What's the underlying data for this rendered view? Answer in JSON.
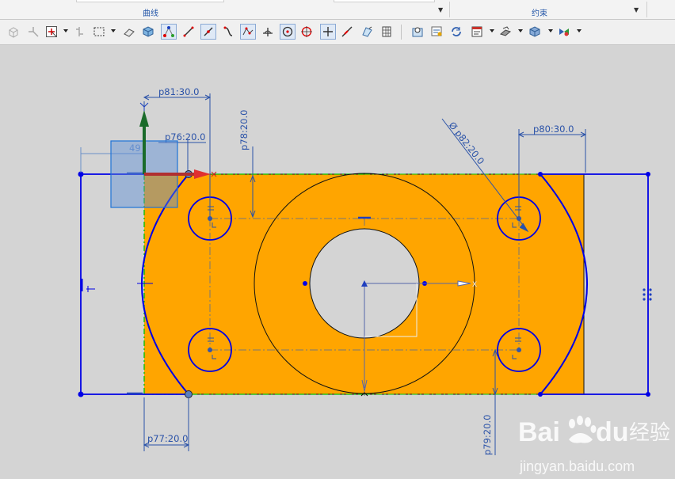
{
  "ribbon": {
    "groups": [
      {
        "title": "曲线"
      },
      {
        "title": "约束"
      }
    ]
  },
  "toolbar": {
    "tools": [
      {
        "name": "associative-model-icon"
      },
      {
        "name": "snap-point-icon"
      },
      {
        "name": "selection-filter-icon"
      },
      {
        "name": "rotate-view-icon"
      },
      {
        "name": "select-box-icon"
      },
      {
        "name": "eraser-icon"
      },
      {
        "name": "solid-box-icon"
      },
      {
        "name": "profile-icon"
      },
      {
        "name": "line-icon"
      },
      {
        "name": "line-tangent-icon"
      },
      {
        "name": "arc-icon"
      },
      {
        "name": "studio-spline-icon"
      },
      {
        "name": "fillet-icon"
      },
      {
        "name": "circle-icon"
      },
      {
        "name": "circle-center-icon"
      },
      {
        "name": "point-icon"
      },
      {
        "name": "quick-extend-icon"
      },
      {
        "name": "make-corner-icon"
      },
      {
        "name": "pattern-curve-icon"
      },
      {
        "name": "fit-view-icon"
      },
      {
        "name": "show-constraints-icon"
      },
      {
        "name": "auto-constrain-icon"
      },
      {
        "name": "relations-browser-icon"
      },
      {
        "name": "sketch-display-icon"
      },
      {
        "name": "shaded-view-icon"
      },
      {
        "name": "render-style-icon"
      }
    ]
  },
  "sketch": {
    "dimensions": {
      "p81": "p81:30.0",
      "p76": "p76:20.0",
      "p78": "p78:20.0",
      "p82": "Ø p82:20.0",
      "p80": "p80:30.0",
      "p77": "p77:20.0",
      "p79": "p79:20.0",
      "temp": "49"
    },
    "axis_labels": {
      "x": "X",
      "y": "Y",
      "origin_y": "Y",
      "center_x": "X"
    },
    "colors": {
      "fill": "#FFA500",
      "curve": "#0000E6",
      "dimension": "#2A52A8",
      "centerline": "#7A7A7A",
      "reference": "#00C000",
      "background": "#D4D4D4"
    }
  },
  "watermark": {
    "brand_a": "Bai",
    "brand_b": "du",
    "brand_cn": "经验",
    "url": "jingyan.baidu.com"
  }
}
